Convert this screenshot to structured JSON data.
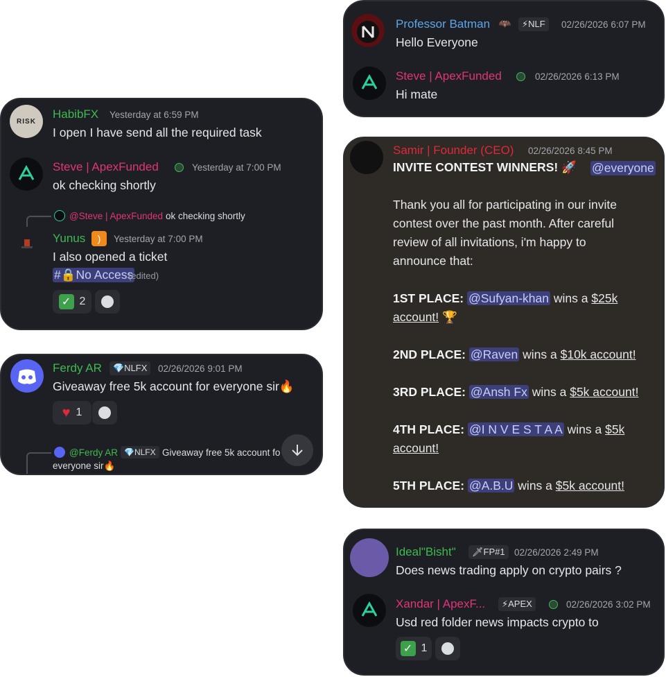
{
  "colors": {
    "card_bg": "#1e1f24",
    "brown_bg": "#2e2a25",
    "green": "#3fb950",
    "pink": "#e0357a",
    "red": "#e0283a",
    "mention": "#3c3f7a"
  },
  "card1": {
    "m1": {
      "name": "Professor Batman",
      "emoji": "🦇",
      "tag": "⚡NLF",
      "time": "02/26/2026 6:07 PM",
      "text": "Hello Everyone"
    },
    "m2": {
      "name": "Steve | ApexFunded",
      "time": "02/26/2026 6:13 PM",
      "text": "Hi mate"
    }
  },
  "card2": {
    "m1": {
      "name": "HabibFX",
      "avatar_text": "RISK",
      "time": "Yesterday at 6:59 PM",
      "text": "I open I have send all the required task"
    },
    "m2": {
      "name": "Steve | ApexFunded",
      "time": "Yesterday at 7:00 PM",
      "text": "ok checking shortly"
    },
    "reply": {
      "name": "@Steve | ApexFunded",
      "text": "ok checking shortly"
    },
    "m3": {
      "name": "Yunus",
      "emoji": "🛜",
      "time": "Yesterday at 7:00 PM",
      "text": "I also opened a ticket",
      "channel": "#🔒No Access",
      "edited": "(edited)",
      "reaction_count": "2"
    }
  },
  "card3": {
    "name": "Samir | Founder (CEO)",
    "time": "02/26/2026 8:45 PM",
    "headline": "INVITE CONTEST WINNERS! 🚀",
    "everyone": "@everyone",
    "intro": [
      "Thank you all for participating in our invite",
      "contest over the past month. After careful",
      "review of all invitations, i'm happy to",
      "announce that:"
    ],
    "places": [
      {
        "label": "1ST PLACE:",
        "user": "@Sufyan-khan",
        "wins": "wins a",
        "prize_a": "$25k",
        "prize_b": "account!",
        "trophy": "🏆"
      },
      {
        "label": "2ND PLACE:",
        "user": "@Raven",
        "wins": "wins a",
        "prize": "$10k account!"
      },
      {
        "label": "3RD PLACE:",
        "user": "@Ansh Fx",
        "wins": "wins a",
        "prize": "$5k account!"
      },
      {
        "label": "4TH PLACE:",
        "user": "@I N V E S T A A",
        "wins": "wins a",
        "prize_a": "$5k",
        "prize_b": "account!"
      },
      {
        "label": "5TH PLACE:",
        "user": "@A.B.U",
        "wins": "wins a",
        "prize": "$5k account!"
      }
    ]
  },
  "card4": {
    "name": "Ferdy AR",
    "tag": "💎NLFX",
    "time": "02/26/2026 9:01 PM",
    "text": "Giveaway free 5k account for everyone sir🔥",
    "reaction_count": "1",
    "reply": {
      "name": "@Ferdy AR",
      "tag": "💎NLFX",
      "text": "Giveaway free 5k account fo",
      "text2": "everyone sir🔥"
    }
  },
  "card5": {
    "m1": {
      "name": "Ideal\"Bisht\"",
      "tag": "🗡FP#1",
      "time": "02/26/2026 2:49 PM",
      "text": "Does news trading apply on crypto pairs ?"
    },
    "m2": {
      "name": "Xandar | ApexF...",
      "tag": "⚡APEX",
      "time": "02/26/2026 3:02 PM",
      "text": "Usd red folder news impacts crypto to",
      "reaction_count": "1"
    }
  }
}
